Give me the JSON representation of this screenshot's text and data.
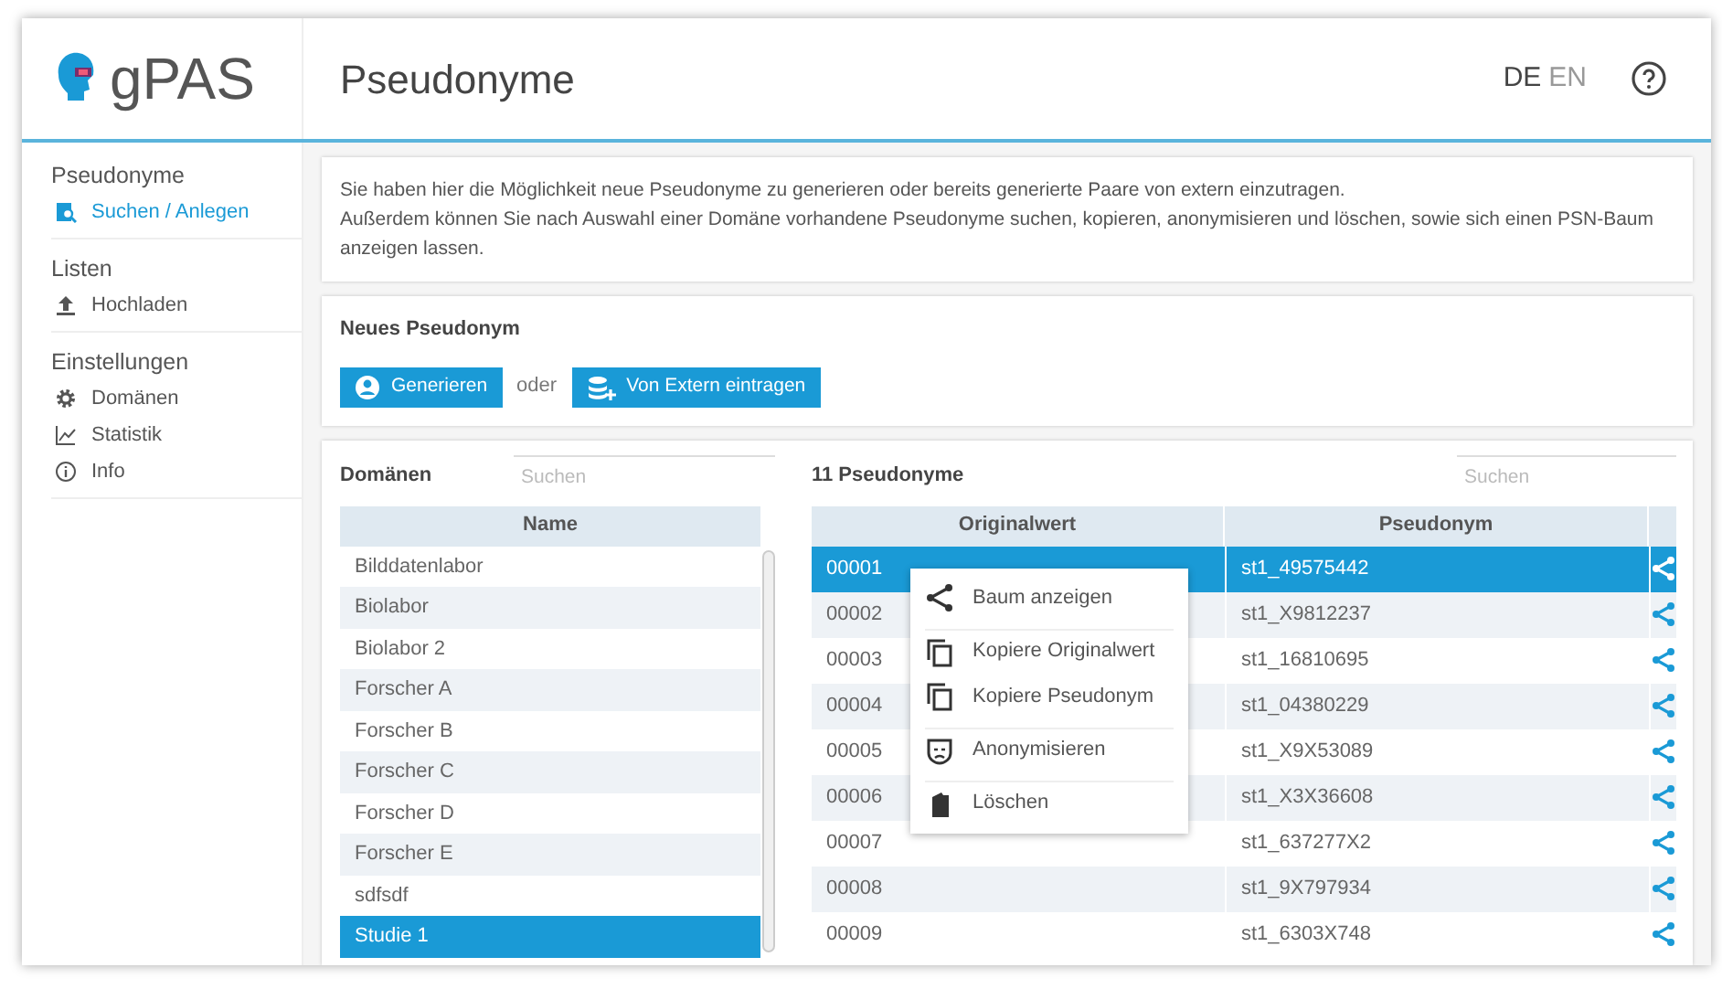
{
  "logo": {
    "text": "gPAS"
  },
  "header": {
    "title": "Pseudonyme",
    "languages": [
      {
        "label": "DE",
        "selected": true
      },
      {
        "label": "EN",
        "selected": false
      }
    ]
  },
  "sidebar": {
    "groups": [
      {
        "title": "Pseudonyme",
        "items": [
          {
            "label": "Suchen / Anlegen",
            "kind": "search",
            "selected": true
          }
        ]
      },
      {
        "title": "Listen",
        "items": [
          {
            "label": "Hochladen",
            "kind": "upload",
            "selected": false
          }
        ]
      },
      {
        "title": "Einstellungen",
        "items": [
          {
            "label": "Domänen",
            "kind": "gear",
            "selected": false
          },
          {
            "label": "Statistik",
            "kind": "chart",
            "selected": false
          },
          {
            "label": "Info",
            "kind": "info",
            "selected": false
          }
        ]
      }
    ]
  },
  "info": {
    "lines": [
      "Sie haben hier die Möglichkeit neue Pseudonyme zu generieren oder bereits generierte Paare von extern einzutragen.",
      "Außerdem können Sie nach Auswahl einer Domäne vorhandene Pseudonyme suchen, kopieren, anonymisieren und löschen, sowie sich einen PSN-Baum anzeigen lassen."
    ]
  },
  "new_pseudonym": {
    "title": "Neues Pseudonym",
    "generate_button": "Generieren",
    "or": "oder",
    "external_button": "Von Extern eintragen"
  },
  "domains": {
    "title": "Domänen",
    "search": {
      "placeholder": "Suchen"
    },
    "column": "Name",
    "rows": [
      {
        "name": "Bilddatenlabor",
        "selected": false
      },
      {
        "name": "Biolabor",
        "selected": false
      },
      {
        "name": "Biolabor 2",
        "selected": false
      },
      {
        "name": "Forscher A",
        "selected": false
      },
      {
        "name": "Forscher B",
        "selected": false
      },
      {
        "name": "Forscher C",
        "selected": false
      },
      {
        "name": "Forscher D",
        "selected": false
      },
      {
        "name": "Forscher E",
        "selected": false
      },
      {
        "name": "sdfsdf",
        "selected": false
      },
      {
        "name": "Studie 1",
        "selected": true
      }
    ]
  },
  "pseudonyms": {
    "title": "11 Pseudonyme",
    "search": {
      "placeholder": "Suchen"
    },
    "columns": [
      "Originalwert",
      "Pseudonym"
    ],
    "rows": [
      {
        "original": "00001",
        "pseudonym": "st1_49575442",
        "selected": true
      },
      {
        "original": "00002",
        "pseudonym": "st1_X9812237",
        "selected": false
      },
      {
        "original": "00003",
        "pseudonym": "st1_16810695",
        "selected": false
      },
      {
        "original": "00004",
        "pseudonym": "st1_04380229",
        "selected": false
      },
      {
        "original": "00005",
        "pseudonym": "st1_X9X53089",
        "selected": false
      },
      {
        "original": "00006",
        "pseudonym": "st1_X3X36608",
        "selected": false
      },
      {
        "original": "00007",
        "pseudonym": "st1_637277X2",
        "selected": false
      },
      {
        "original": "00008",
        "pseudonym": "st1_9X797934",
        "selected": false
      },
      {
        "original": "00009",
        "pseudonym": "st1_6303X748",
        "selected": false
      }
    ]
  },
  "context_menu": {
    "items": [
      {
        "label": "Baum anzeigen",
        "kind": "tree"
      },
      {
        "label": "Kopiere Originalwert",
        "kind": "copy"
      },
      {
        "label": "Kopiere Pseudonym",
        "kind": "copy"
      },
      {
        "label": "Anonymisieren",
        "kind": "mask"
      },
      {
        "label": "Löschen",
        "kind": "delete"
      }
    ]
  }
}
